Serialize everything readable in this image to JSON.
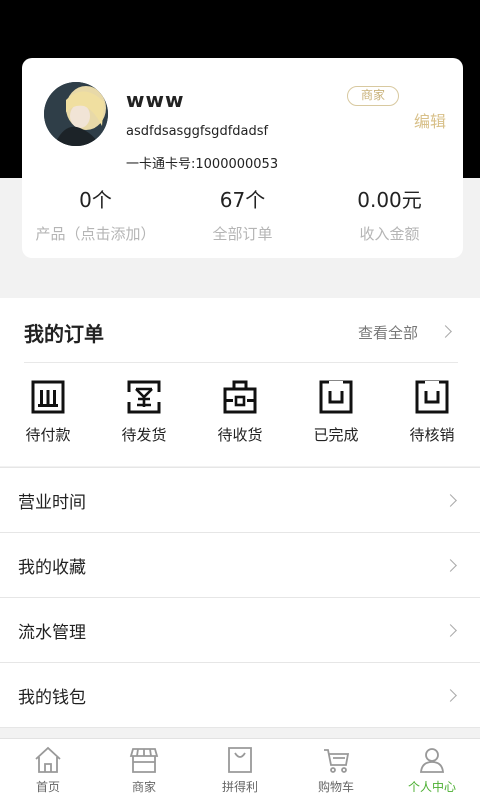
{
  "profile": {
    "username": "www",
    "badge": "商家",
    "edit_label": "编辑",
    "account": "asdfdsasggfsgdfdadsf",
    "card_number": "一卡通卡号:1000000053"
  },
  "stats": [
    {
      "value": "0个",
      "label": "产品（点击添加）"
    },
    {
      "value": "67个",
      "label": "全部订单"
    },
    {
      "value": "0.00元",
      "label": "收入金额"
    }
  ],
  "orders": {
    "title": "我的订单",
    "view_all": "查看全部",
    "items": [
      {
        "label": "待付款",
        "icon": "pending-payment-icon"
      },
      {
        "label": "待发货",
        "icon": "pending-shipment-icon"
      },
      {
        "label": "待收货",
        "icon": "pending-receipt-icon"
      },
      {
        "label": "已完成",
        "icon": "completed-icon"
      },
      {
        "label": "待核销",
        "icon": "pending-verification-icon"
      }
    ]
  },
  "menu": [
    {
      "label": "营业时间"
    },
    {
      "label": "我的收藏"
    },
    {
      "label": "流水管理"
    },
    {
      "label": "我的钱包"
    }
  ],
  "tabbar": {
    "active_color": "#4caf32",
    "items": [
      {
        "label": "首页",
        "icon": "home-icon"
      },
      {
        "label": "商家",
        "icon": "shop-icon"
      },
      {
        "label": "拼得利",
        "icon": "bag-icon"
      },
      {
        "label": "购物车",
        "icon": "cart-icon"
      },
      {
        "label": "个人中心",
        "icon": "person-icon"
      }
    ]
  }
}
